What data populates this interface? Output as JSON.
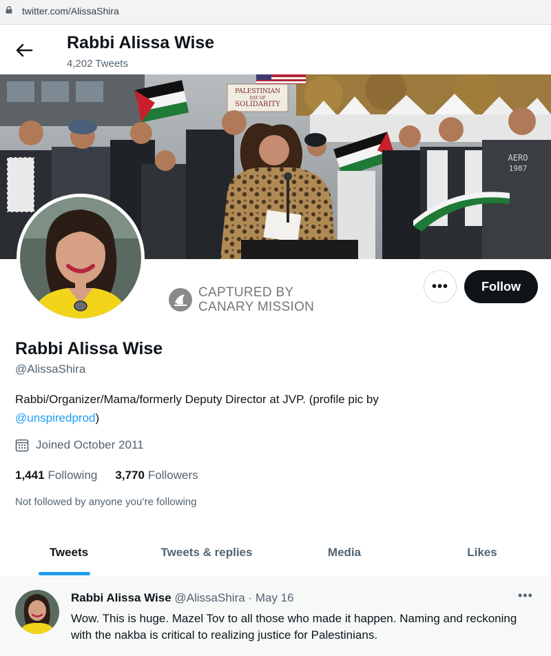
{
  "browser": {
    "url": "twitter.com/AlissaShira"
  },
  "header": {
    "name": "Rabbi Alissa Wise",
    "tweet_count": "4,202 Tweets"
  },
  "banner": {
    "sign_line1": "PALESTINIAN",
    "sign_line2": "DAY OF",
    "sign_line3": "SOLIDARITY",
    "shirt_line1": "AERO",
    "shirt_line2": "1987"
  },
  "watermark": {
    "line1": "CAPTURED BY",
    "line2": "CANARY MISSION"
  },
  "actions": {
    "more": "•••",
    "follow": "Follow"
  },
  "profile": {
    "name": "Rabbi Alissa Wise",
    "handle": "@AlissaShira",
    "bio_text": "Rabbi/Organizer/Mama/formerly Deputy Director at JVP. (profile pic by",
    "bio_link": "@unspiredprod",
    "bio_tail": ")",
    "joined": "Joined October 2011",
    "following_count": "1,441",
    "following_label": "Following",
    "followers_count": "3,770",
    "followers_label": "Followers",
    "not_followed": "Not followed by anyone you’re following"
  },
  "tabs": [
    {
      "label": "Tweets"
    },
    {
      "label": "Tweets & replies"
    },
    {
      "label": "Media"
    },
    {
      "label": "Likes"
    }
  ],
  "tweet": {
    "name": "Rabbi Alissa Wise",
    "handle": "@AlissaShira",
    "separator": "·",
    "date": "May 16",
    "more": "•••",
    "text": "Wow. This is huge. Mazel Tov to all those who made it happen. Naming and reckoning with the nakba is critical to realizing justice for Palestinians."
  }
}
